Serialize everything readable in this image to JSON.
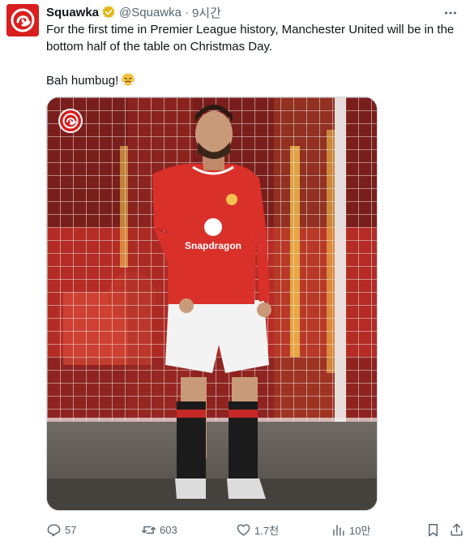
{
  "tweet": {
    "author_name": "Squawka",
    "handle": "@Squawka",
    "separator": "·",
    "time": "9시간",
    "text_line1": "For the first time in Premier League history, Manchester United will be in the bottom half of the table on Christmas Day.",
    "text_line2": "Bah humbug!",
    "emoji": "face-with-steam-from-nose"
  },
  "media": {
    "shirt_sponsor": "Snapdragon"
  },
  "actions": {
    "replies": "57",
    "reposts": "603",
    "likes": "1.7천",
    "views": "10만"
  },
  "colors": {
    "brand_red": "#d81e1e",
    "verified_gold": "#e2b719",
    "text": "#0f1419",
    "muted": "#536471"
  },
  "icons": [
    "more-icon",
    "verified-badge-icon",
    "reply-icon",
    "repost-icon",
    "like-icon",
    "views-icon",
    "bookmark-icon",
    "share-icon"
  ]
}
